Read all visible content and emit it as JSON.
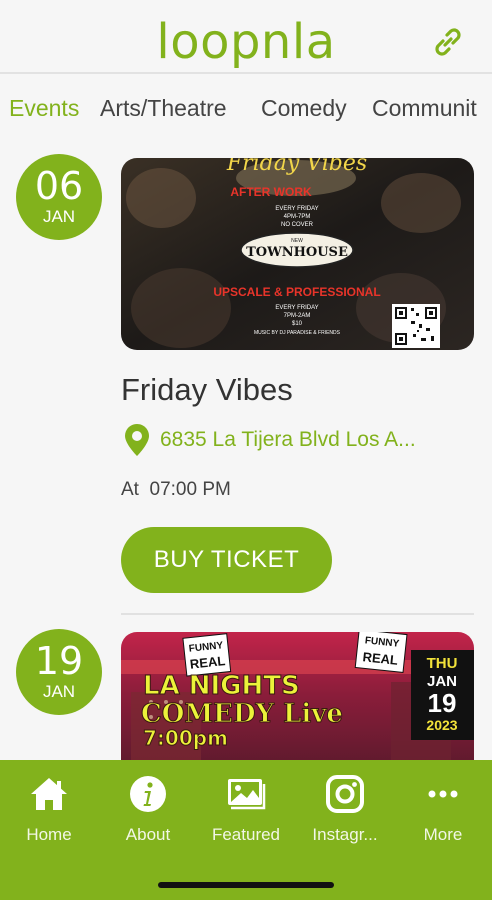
{
  "app": {
    "brand": "loopnla"
  },
  "tabs": [
    {
      "label": "Events",
      "active": true
    },
    {
      "label": "Arts/Theatre",
      "active": false
    },
    {
      "label": "Comedy",
      "active": false
    },
    {
      "label": "Communit",
      "active": false
    }
  ],
  "events": [
    {
      "day": "06",
      "month": "JAN",
      "title": "Friday Vibes",
      "address": "6835 La Tijera Blvd Los A...",
      "time_prefix": "At",
      "time": "07:00 PM",
      "button_label": "BUY TICKET",
      "poster": {
        "heading": "Friday Vibes",
        "line1": "AFTER WORK",
        "line2": "EVERY FRIDAY",
        "line3": "4PM-7PM",
        "line4": "NO COVER",
        "venue_top": "NEW",
        "venue": "TOWNHOUSE",
        "line5": "UPSCALE & PROFESSIONAL",
        "line6": "EVERY FRIDAY",
        "line7": "7PM-2AM",
        "line8": "$10",
        "line9": "MUSIC BY DJ PARADISE & FRIENDS"
      }
    },
    {
      "day": "19",
      "month": "JAN",
      "poster": {
        "sign1": "FUNNY\nREAL",
        "headline1": "LA NIGHTS",
        "headline2": "COMEDY Live",
        "headline3": "7:00pm",
        "date_day": "THU",
        "date_mon": "JAN",
        "date_num": "19",
        "date_year": "2023"
      }
    }
  ],
  "bottom_nav": [
    {
      "label": "Home",
      "icon": "home-icon"
    },
    {
      "label": "About",
      "icon": "info-icon"
    },
    {
      "label": "Featured",
      "icon": "image-gallery-icon"
    },
    {
      "label": "Instagr...",
      "icon": "instagram-icon"
    },
    {
      "label": "More",
      "icon": "more-dots-icon"
    }
  ],
  "colors": {
    "accent": "#82b21c",
    "background": "#f6f6f6",
    "text": "#333333"
  }
}
